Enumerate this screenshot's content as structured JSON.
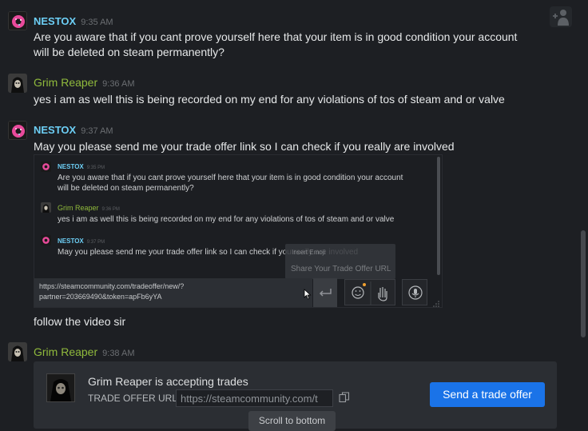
{
  "messages": [
    {
      "author": "NESTOX",
      "time": "9:35 AM",
      "text_line1": "Are you aware that if you cant prove yourself here that your item is in good condition your account",
      "text_line2": "will be deleted on steam permanently?"
    },
    {
      "author": "Grim Reaper",
      "time": "9:36 AM",
      "text_line1": "yes i am as well this is being recorded on my end for any violations of tos of steam and or valve"
    },
    {
      "author": "NESTOX",
      "time": "9:37 AM",
      "text_line1": "May you please send me your trade offer link so I can check if you really are involved"
    },
    {
      "author": "",
      "time": "",
      "text_line1": "follow the video sir"
    },
    {
      "author": "Grim Reaper",
      "time": "9:38 AM"
    }
  ],
  "embed": {
    "m1_author": "NESTOX",
    "m1_time": "9:35 PM",
    "m1_line1": "Are you aware that if you cant prove yourself here that your item is in good condition your account",
    "m1_line2": "will be deleted on steam permanently?",
    "m2_author": "Grim Reaper",
    "m2_time": "9:36 PM",
    "m2_line1": "yes i am as well this is being recorded on my end for any violations of tos of steam and or valve",
    "m3_author": "NESTOX",
    "m3_time": "9:37 PM",
    "m3_line1": "May you please send me your trade offer link so I can check if you really are involved",
    "tooltip_title": "Insert Emoji",
    "tooltip_item": "Share Your Trade Offer URL",
    "input_line1": "https://steamcommunity.com/tradeoffer/new/?",
    "input_line2": "partner=203669490&token=apFb6yYA"
  },
  "trade_card": {
    "title": "Grim Reaper is accepting trades",
    "url_label": "TRADE OFFER URL:",
    "url_value": "https://steamcommunity.com/t",
    "button_label": "Send a trade offer"
  },
  "scroll_to_bottom": "Scroll to bottom",
  "colors": {
    "nestox_name": "#6dcff6",
    "reaper_name": "#90ba3c",
    "send_button": "#1a73e8",
    "background": "#1d1f23"
  }
}
